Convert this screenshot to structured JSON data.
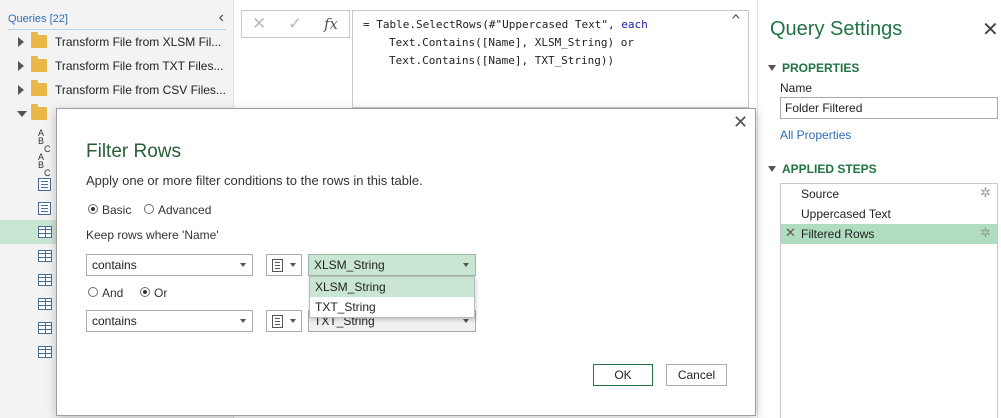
{
  "queries_pane": {
    "title": "Queries [22]",
    "collapse_glyph": "‹",
    "groups": [
      {
        "label": "Transform File from XLSM Fil...",
        "expanded": false
      },
      {
        "label": "Transform File from TXT Files...",
        "expanded": false
      },
      {
        "label": "Transform File from CSV Files...",
        "expanded": false
      },
      {
        "label": "",
        "expanded": true
      }
    ],
    "items": [
      {
        "icon": "abc-text-icon",
        "selected": false
      },
      {
        "icon": "abc-text-icon",
        "selected": false
      },
      {
        "icon": "list-icon",
        "selected": false
      },
      {
        "icon": "list-icon",
        "selected": false
      },
      {
        "icon": "table-icon",
        "selected": true
      },
      {
        "icon": "table-icon",
        "selected": false
      },
      {
        "icon": "table-icon",
        "selected": false
      },
      {
        "icon": "table-icon",
        "selected": false
      },
      {
        "icon": "table-icon",
        "selected": false
      },
      {
        "icon": "table-icon",
        "selected": false
      }
    ]
  },
  "formula_bar": {
    "cancel_glyph": "✕",
    "commit_glyph": "✓",
    "fx_glyph": "fx",
    "line1_pre": "= Table.SelectRows(#\"Uppercased Text\", ",
    "line1_kw": "each",
    "line2": "Text.Contains([Name], XLSM_String) or",
    "line3": "Text.Contains([Name], TXT_String))",
    "expand_glyph": "^"
  },
  "query_settings": {
    "title": "Query Settings",
    "close_glyph": "✕",
    "properties_heading": "PROPERTIES",
    "name_label": "Name",
    "name_value": "Folder Filtered",
    "all_properties_link": "All Properties",
    "applied_steps_heading": "APPLIED STEPS",
    "steps": [
      {
        "label": "Source",
        "has_gear": true,
        "selected": false,
        "deletable": false
      },
      {
        "label": "Uppercased Text",
        "has_gear": false,
        "selected": false,
        "deletable": false
      },
      {
        "label": "Filtered Rows",
        "has_gear": true,
        "selected": true,
        "deletable": true
      }
    ],
    "gear_glyph": "✲",
    "delete_glyph": "✕"
  },
  "dialog": {
    "close_glyph": "✕",
    "title": "Filter Rows",
    "description": "Apply one or more filter conditions to the rows in this table.",
    "mode_basic_label": "Basic",
    "mode_advanced_label": "Advanced",
    "mode_selected": "Basic",
    "keep_rows_label": "Keep rows where 'Name'",
    "condition1": {
      "operator": "contains",
      "value": "XLSM_String"
    },
    "and_label": "And",
    "or_label": "Or",
    "logic_selected": "Or",
    "condition2": {
      "operator": "contains",
      "value": "TXT_String"
    },
    "value_dropdown_options": [
      {
        "label": "XLSM_String",
        "highlighted": true
      },
      {
        "label": "TXT_String",
        "highlighted": false
      }
    ],
    "ok_label": "OK",
    "cancel_label": "Cancel"
  },
  "colors": {
    "accent_green": "#217346",
    "selection_green": "#c9e6d3",
    "link_blue": "#2f6cb5",
    "folder_yellow": "#e9b848"
  }
}
